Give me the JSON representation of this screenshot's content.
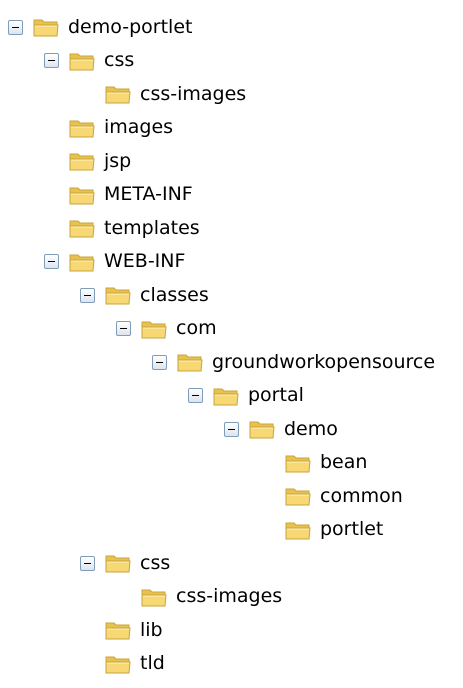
{
  "tree": [
    {
      "label": "demo-portlet",
      "depth": 0,
      "expanded": true,
      "has_children": true
    },
    {
      "label": "css",
      "depth": 1,
      "expanded": true,
      "has_children": true
    },
    {
      "label": "css-images",
      "depth": 2,
      "expanded": false,
      "has_children": false
    },
    {
      "label": "images",
      "depth": 1,
      "expanded": false,
      "has_children": false
    },
    {
      "label": "jsp",
      "depth": 1,
      "expanded": false,
      "has_children": false
    },
    {
      "label": "META-INF",
      "depth": 1,
      "expanded": false,
      "has_children": false
    },
    {
      "label": "templates",
      "depth": 1,
      "expanded": false,
      "has_children": false
    },
    {
      "label": "WEB-INF",
      "depth": 1,
      "expanded": true,
      "has_children": true
    },
    {
      "label": "classes",
      "depth": 2,
      "expanded": true,
      "has_children": true
    },
    {
      "label": "com",
      "depth": 3,
      "expanded": true,
      "has_children": true
    },
    {
      "label": "groundworkopensource",
      "depth": 4,
      "expanded": true,
      "has_children": true
    },
    {
      "label": "portal",
      "depth": 5,
      "expanded": true,
      "has_children": true
    },
    {
      "label": "demo",
      "depth": 6,
      "expanded": true,
      "has_children": true
    },
    {
      "label": "bean",
      "depth": 7,
      "expanded": false,
      "has_children": false
    },
    {
      "label": "common",
      "depth": 7,
      "expanded": false,
      "has_children": false
    },
    {
      "label": "portlet",
      "depth": 7,
      "expanded": false,
      "has_children": false
    },
    {
      "label": "css",
      "depth": 2,
      "expanded": true,
      "has_children": true
    },
    {
      "label": "css-images",
      "depth": 3,
      "expanded": false,
      "has_children": false
    },
    {
      "label": "lib",
      "depth": 2,
      "expanded": false,
      "has_children": false
    },
    {
      "label": "tld",
      "depth": 2,
      "expanded": false,
      "has_children": false
    }
  ],
  "icons": {
    "toggle": "minus-box-icon",
    "folder": "folder-icon"
  },
  "colors": {
    "folder_fill": "#f7d874",
    "folder_edge": "#c9a43a",
    "toggle_border": "#7f9db9"
  }
}
